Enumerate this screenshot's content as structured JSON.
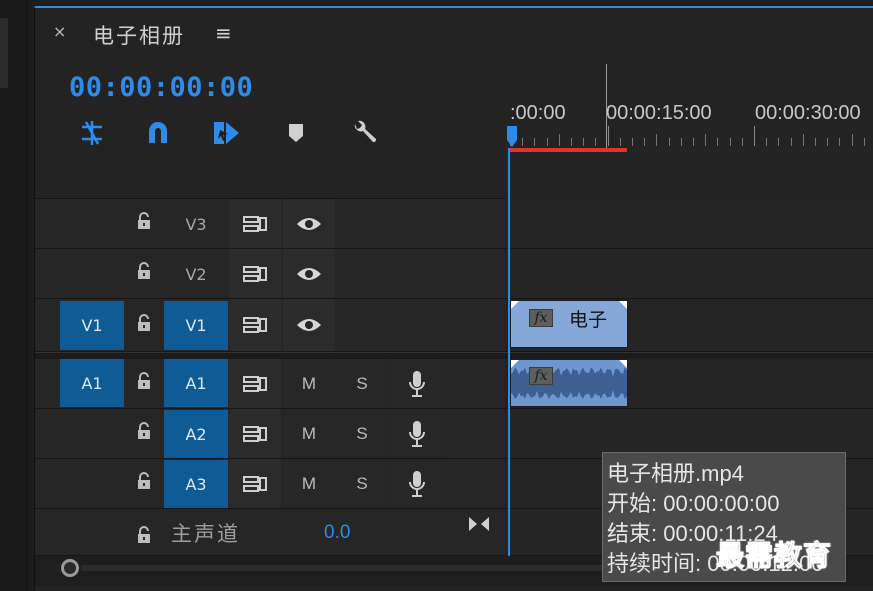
{
  "panel": {
    "close_glyph": "×",
    "title": "电子相册",
    "menu_glyph": "≡",
    "accent_color": "#2d8ceb"
  },
  "timecode": "00:00:00:00",
  "toolbar": {
    "tools": [
      "insert-overwrite-sequences-icon",
      "snap-magnet-icon",
      "linked-selection-icon",
      "add-marker-icon",
      "timeline-settings-wrench-icon"
    ]
  },
  "ruler": {
    "labels": [
      ":00:00",
      "00:00:15:00",
      "00:00:30:00"
    ]
  },
  "tracks": {
    "video": [
      {
        "target": "V3",
        "source": "",
        "targeted": false
      },
      {
        "target": "V2",
        "source": "",
        "targeted": false
      },
      {
        "target": "V1",
        "source": "V1",
        "targeted": true
      }
    ],
    "audio": [
      {
        "target": "A1",
        "source": "A1",
        "targeted": true,
        "mute": "M",
        "solo": "S"
      },
      {
        "target": "A2",
        "source": "",
        "targeted": true,
        "mute": "M",
        "solo": "S"
      },
      {
        "target": "A3",
        "source": "",
        "targeted": true,
        "mute": "M",
        "solo": "S"
      }
    ],
    "master": {
      "label": "主声道",
      "value": "0.0"
    }
  },
  "clips": {
    "video": {
      "fx": "fx",
      "name": "电子"
    },
    "audio": {
      "fx": "fx"
    }
  },
  "tooltip": {
    "name": "电子相册.mp4",
    "start": "开始: 00:00:00:00",
    "end": "结束: 00:00:11:24",
    "duration": "持续时间: 00:00:12:00"
  },
  "watermark": "最需教育"
}
